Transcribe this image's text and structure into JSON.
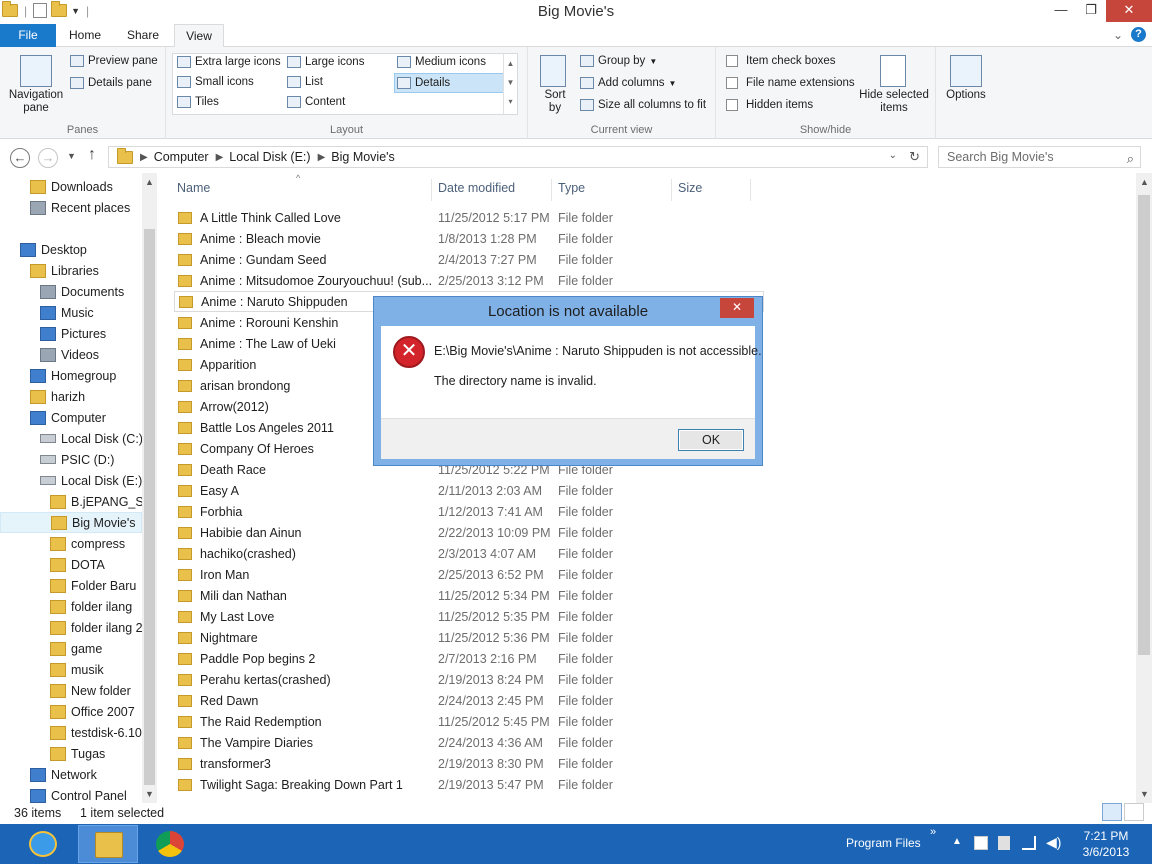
{
  "window": {
    "title": "Big Movie's"
  },
  "tabs": {
    "file": "File",
    "home": "Home",
    "share": "Share",
    "view": "View"
  },
  "ribbon": {
    "panes": {
      "label": "Panes",
      "navigation_pane": "Navigation pane",
      "preview_pane": "Preview pane",
      "details_pane": "Details pane"
    },
    "layout": {
      "label": "Layout",
      "items": [
        "Extra large icons",
        "Large icons",
        "Medium icons",
        "Small icons",
        "List",
        "Details",
        "Tiles",
        "Content"
      ],
      "selected": "Details"
    },
    "current_view": {
      "label": "Current view",
      "sort_by": "Sort by",
      "group_by": "Group by",
      "add_columns": "Add columns",
      "size_all_columns": "Size all columns to fit"
    },
    "show_hide": {
      "label": "Show/hide",
      "item_check_boxes": "Item check boxes",
      "file_name_extensions": "File name extensions",
      "hidden_items": "Hidden items",
      "hide_selected_items": "Hide selected items"
    },
    "options": "Options"
  },
  "address": {
    "crumbs": [
      "Computer",
      "Local Disk (E:)",
      "Big Movie's"
    ],
    "search_placeholder": "Search Big Movie's"
  },
  "navpane": {
    "items": [
      {
        "label": "Downloads",
        "icon": "folder-icon"
      },
      {
        "label": "Recent places",
        "icon": "recent-icon"
      },
      {
        "label": "Desktop",
        "icon": "desktop-icon"
      },
      {
        "label": "Libraries",
        "icon": "libraries-icon"
      },
      {
        "label": "Documents",
        "icon": "documents-icon"
      },
      {
        "label": "Music",
        "icon": "music-icon"
      },
      {
        "label": "Pictures",
        "icon": "pictures-icon"
      },
      {
        "label": "Videos",
        "icon": "videos-icon"
      },
      {
        "label": "Homegroup",
        "icon": "homegroup-icon"
      },
      {
        "label": "harizh",
        "icon": "user-icon"
      },
      {
        "label": "Computer",
        "icon": "computer-icon"
      },
      {
        "label": "Local Disk (C:)",
        "icon": "drive-icon"
      },
      {
        "label": "PSIC (D:)",
        "icon": "drive-icon"
      },
      {
        "label": "Local Disk (E:)",
        "icon": "drive-icon"
      },
      {
        "label": "B.jEPANG_SM",
        "icon": "folder-icon"
      },
      {
        "label": "Big Movie's",
        "icon": "folder-icon"
      },
      {
        "label": "compress",
        "icon": "folder-icon"
      },
      {
        "label": "DOTA",
        "icon": "folder-icon"
      },
      {
        "label": "Folder Baru",
        "icon": "folder-icon"
      },
      {
        "label": "folder ilang",
        "icon": "folder-icon"
      },
      {
        "label": "folder ilang 2",
        "icon": "folder-icon"
      },
      {
        "label": "game",
        "icon": "folder-icon"
      },
      {
        "label": "musik",
        "icon": "folder-icon"
      },
      {
        "label": "New folder",
        "icon": "folder-icon"
      },
      {
        "label": "Office 2007",
        "icon": "folder-icon"
      },
      {
        "label": "testdisk-6.10",
        "icon": "folder-icon"
      },
      {
        "label": "Tugas",
        "icon": "folder-icon"
      },
      {
        "label": "Network",
        "icon": "network-icon"
      },
      {
        "label": "Control Panel",
        "icon": "control-panel-icon"
      }
    ]
  },
  "columns": {
    "name": "Name",
    "date": "Date modified",
    "type": "Type",
    "size": "Size"
  },
  "files": [
    {
      "name": "A Little Think Called Love",
      "date": "11/25/2012 5:17 PM",
      "type": "File folder"
    },
    {
      "name": "Anime : Bleach movie",
      "date": "1/8/2013 1:28 PM",
      "type": "File folder"
    },
    {
      "name": "Anime : Gundam Seed",
      "date": "2/4/2013 7:27 PM",
      "type": "File folder"
    },
    {
      "name": "Anime : Mitsudomoe Zouryouchuu! (sub...",
      "date": "2/25/2013 3:12 PM",
      "type": "File folder"
    },
    {
      "name": "Anime : Naruto Shippuden",
      "date": "",
      "type": ""
    },
    {
      "name": "Anime : Rorouni Kenshin",
      "date": "",
      "type": ""
    },
    {
      "name": "Anime : The Law of Ueki",
      "date": "",
      "type": ""
    },
    {
      "name": "Apparition",
      "date": "",
      "type": ""
    },
    {
      "name": "arisan brondong",
      "date": "",
      "type": ""
    },
    {
      "name": "Arrow(2012)",
      "date": "",
      "type": ""
    },
    {
      "name": "Battle Los Angeles 2011",
      "date": "",
      "type": ""
    },
    {
      "name": "Company Of Heroes",
      "date": "",
      "type": ""
    },
    {
      "name": "Death Race",
      "date": "11/25/2012 5:22 PM",
      "type": "File folder"
    },
    {
      "name": "Easy A",
      "date": "2/11/2013 2:03 AM",
      "type": "File folder"
    },
    {
      "name": "Forbhia",
      "date": "1/12/2013 7:41 AM",
      "type": "File folder"
    },
    {
      "name": "Habibie dan Ainun",
      "date": "2/22/2013 10:09 PM",
      "type": "File folder"
    },
    {
      "name": "hachiko(crashed)",
      "date": "2/3/2013 4:07 AM",
      "type": "File folder"
    },
    {
      "name": "Iron Man",
      "date": "2/25/2013 6:52 PM",
      "type": "File folder"
    },
    {
      "name": "Mili dan Nathan",
      "date": "11/25/2012 5:34 PM",
      "type": "File folder"
    },
    {
      "name": "My Last Love",
      "date": "11/25/2012 5:35 PM",
      "type": "File folder"
    },
    {
      "name": "Nightmare",
      "date": "11/25/2012 5:36 PM",
      "type": "File folder"
    },
    {
      "name": "Paddle Pop begins 2",
      "date": "2/7/2013 2:16 PM",
      "type": "File folder"
    },
    {
      "name": "Perahu kertas(crashed)",
      "date": "2/19/2013 8:24 PM",
      "type": "File folder"
    },
    {
      "name": "Red Dawn",
      "date": "2/24/2013 2:45 PM",
      "type": "File folder"
    },
    {
      "name": "The Raid Redemption",
      "date": "11/25/2012 5:45 PM",
      "type": "File folder"
    },
    {
      "name": "The Vampire Diaries",
      "date": "2/24/2013 4:36 AM",
      "type": "File folder"
    },
    {
      "name": "transformer3",
      "date": "2/19/2013 8:30 PM",
      "type": "File folder"
    },
    {
      "name": "Twilight Saga: Breaking Down Part 1",
      "date": "2/19/2013 5:47 PM",
      "type": "File folder"
    }
  ],
  "status": {
    "items": "36 items",
    "selected": "1 item selected"
  },
  "dialog": {
    "title": "Location is not available",
    "message": "E:\\Big Movie's\\Anime : Naruto Shippuden is not accessible.",
    "detail": "The directory name is invalid.",
    "ok": "OK"
  },
  "taskbar": {
    "program_files": "Program Files",
    "time": "7:21 PM",
    "date": "3/6/2013"
  },
  "colors": {
    "accent": "#1979ca",
    "taskbar": "#1b64b6",
    "close": "#c7463b",
    "error": "#d3242b"
  }
}
